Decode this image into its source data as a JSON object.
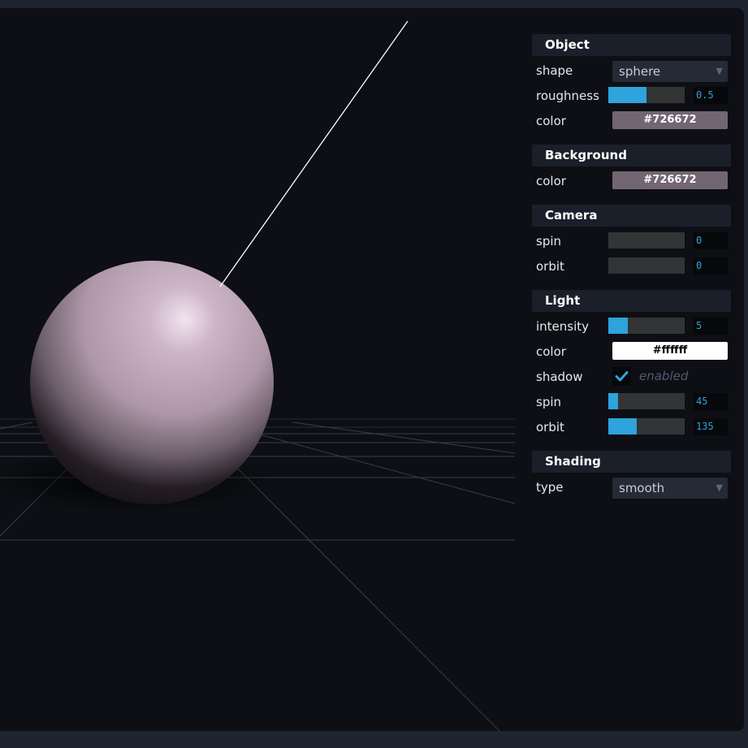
{
  "panel": {
    "object": {
      "title": "Object",
      "shape_label": "shape",
      "shape_value": "sphere",
      "roughness_label": "roughness",
      "roughness_value": "0.5",
      "roughness_fraction": 0.5,
      "color_label": "color",
      "color_value": "#726672"
    },
    "background": {
      "title": "Background",
      "color_label": "color",
      "color_value": "#726672"
    },
    "camera": {
      "title": "Camera",
      "spin_label": "spin",
      "spin_value": "0",
      "spin_fraction": 0,
      "orbit_label": "orbit",
      "orbit_value": "0",
      "orbit_fraction": 0
    },
    "light": {
      "title": "Light",
      "intensity_label": "intensity",
      "intensity_value": "5",
      "intensity_fraction": 0.25,
      "color_label": "color",
      "color_value": "#ffffff",
      "shadow_label": "shadow",
      "shadow_checked": true,
      "shadow_text": "enabled",
      "spin_label": "spin",
      "spin_value": "45",
      "spin_fraction": 0.125,
      "orbit_label": "orbit",
      "orbit_value": "135",
      "orbit_fraction": 0.375
    },
    "shading": {
      "title": "Shading",
      "type_label": "type",
      "type_value": "smooth"
    }
  },
  "icons": {
    "dropdown": "triangle-down",
    "checkbox": "checkmark"
  },
  "colors": {
    "accent": "#2ea3dc",
    "panel_header": "#1a1f29",
    "viewport_bg": "#0d0f14",
    "object_swatch": "#726672",
    "light_swatch": "#ffffff"
  }
}
